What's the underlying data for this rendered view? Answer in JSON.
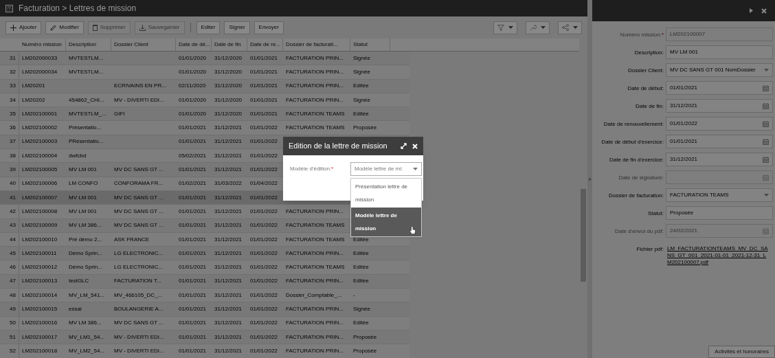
{
  "window": {
    "title": "Facturation > Lettres de mission"
  },
  "toolbar": {
    "buttons": [
      {
        "kind": "icon",
        "label": "Ajouter",
        "disabled": false
      },
      {
        "kind": "icon",
        "label": "Modifier",
        "disabled": false
      },
      {
        "kind": "icon",
        "label": "Supprimer",
        "disabled": true
      },
      {
        "kind": "icon",
        "label": "Sauvegarder",
        "disabled": true
      },
      {
        "kind": "text",
        "label": "Editer",
        "disabled": false
      },
      {
        "kind": "text",
        "label": "Signer",
        "disabled": false
      },
      {
        "kind": "text",
        "label": "Envoyer",
        "disabled": false
      }
    ]
  },
  "table": {
    "columns": [
      "Numéro mission",
      "Description",
      "Dossier Client",
      "Date de dé...",
      "Date de fin",
      "Date de re...",
      "Dossier de facturati...",
      "Statut"
    ],
    "rows": [
      {
        "number": "31",
        "selected": false,
        "cells": [
          "LM202000033",
          "MVTESTLM...",
          null,
          "01/01/2020",
          "31/12/2020",
          "01/01/2021",
          "FACTURATION PRIN...",
          "Signée"
        ]
      },
      {
        "number": "32",
        "selected": false,
        "cells": [
          "LM202000034",
          "MVTESTLM...",
          null,
          "01/01/2020",
          "31/12/2020",
          "01/01/2021",
          "FACTURATION PRIN...",
          "Signée"
        ]
      },
      {
        "number": "33",
        "selected": false,
        "cells": [
          "LM20201",
          null,
          "ECRIVAINS EN PR...",
          "02/11/2020",
          "31/12/2020",
          "01/01/2021",
          "FACTURATION PRIN...",
          "Editée"
        ]
      },
      {
        "number": "34",
        "selected": false,
        "cells": [
          "LM20202",
          "454862_CHI...",
          "MV - DIVERTI EDI...",
          "01/01/2020",
          "31/12/2020",
          "01/01/2021",
          "FACTURATION PRIN...",
          "Signée"
        ]
      },
      {
        "number": "35",
        "selected": false,
        "cells": [
          "LM202100001",
          "MVTESTLM_...",
          "GIFI",
          "01/01/2020",
          "31/12/2020",
          "01/01/2021",
          "FACTURATION TEAMS",
          "Editée"
        ]
      },
      {
        "number": "36",
        "selected": false,
        "cells": [
          "LM202100002",
          "Présentatio...",
          null,
          "01/01/2021",
          "31/12/2021",
          "01/01/2022",
          "FACTURATION TEAMS",
          "Proposée"
        ]
      },
      {
        "number": "37",
        "selected": false,
        "cells": [
          "LM202100003",
          "PRésentatio...",
          null,
          "01/01/2021",
          "31/12/2021",
          "01/01/2022",
          null,
          null
        ]
      },
      {
        "number": "38",
        "selected": false,
        "cells": [
          "LM202100004",
          "dwfcbd",
          null,
          "05/02/2021",
          "31/12/2021",
          "01/01/2022",
          null,
          null
        ]
      },
      {
        "number": "39",
        "selected": false,
        "cells": [
          "LM202100005",
          "MV LM 001",
          "MV DC SANS GT ...",
          "01/01/2021",
          "31/12/2021",
          "01/01/2022",
          null,
          null
        ]
      },
      {
        "number": "40",
        "selected": false,
        "cells": [
          "LM202100006",
          "LM CONFO",
          "CONFORAMA FR...",
          "01/02/2021",
          "31/03/2022",
          "01/04/2022",
          null,
          null
        ]
      },
      {
        "number": "41",
        "selected": true,
        "cells": [
          "LM202100007",
          "MV LM 001",
          "MV DC SANS GT ...",
          "01/01/2021",
          "31/12/2021",
          "01/01/2022",
          null,
          null
        ]
      },
      {
        "number": "42",
        "selected": false,
        "cells": [
          "LM202100008",
          "MV LM 001",
          "MV DC SANS GT ...",
          "01/01/2021",
          "31/12/2021",
          "01/01/2022",
          "FACTURATION PRIN...",
          null
        ]
      },
      {
        "number": "43",
        "selected": false,
        "cells": [
          "LM202100009",
          "MV LM 386...",
          "MV DC SANS GT ...",
          "01/01/2021",
          "31/12/2021",
          "01/01/2022",
          "FACTURATION TEAMS",
          null
        ]
      },
      {
        "number": "44",
        "selected": false,
        "cells": [
          "LM202100010",
          "Pré démo 2...",
          "ASK FRANCE",
          "01/01/2021",
          "31/12/2021",
          "01/01/2022",
          "FACTURATION TEAMS",
          "Editée"
        ]
      },
      {
        "number": "45",
        "selected": false,
        "cells": [
          "LM202100011",
          "Démo Sprin...",
          "LG ELECTRONIC...",
          "01/01/2021",
          "31/12/2021",
          "01/01/2022",
          "FACTURATION PRIN...",
          "Editée"
        ]
      },
      {
        "number": "46",
        "selected": false,
        "cells": [
          "LM202100012",
          "Démo Sprin...",
          "LG ELECTRONIC...",
          "01/01/2021",
          "31/12/2021",
          "01/01/2022",
          "FACTURATION TEAMS",
          "Editée"
        ]
      },
      {
        "number": "47",
        "selected": false,
        "cells": [
          "LM202100013",
          "testGLC",
          "FACTURATION T...",
          "01/01/2021",
          "31/12/2021",
          "01/01/2022",
          "FACTURATION PRIN...",
          "Editée"
        ]
      },
      {
        "number": "48",
        "selected": false,
        "cells": [
          "LM202100014",
          "MV_LM_541...",
          "MV_466105_DC_...",
          "01/01/2021",
          "31/12/2021",
          "01/01/2022",
          "Dossier_Comptable_...",
          "-"
        ]
      },
      {
        "number": "49",
        "selected": false,
        "cells": [
          "LM202100015",
          "essai",
          "BOULANGERIE A...",
          "01/01/2021",
          "31/12/2021",
          "01/01/2022",
          "FACTURATION PRIN...",
          "Signée"
        ]
      },
      {
        "number": "50",
        "selected": false,
        "cells": [
          "LM202100016",
          "MV LM 386...",
          "MV DC SANS GT ...",
          "01/01/2021",
          "31/12/2021",
          "01/01/2022",
          "FACTURATION PRIN...",
          "Editée"
        ]
      },
      {
        "number": "51",
        "selected": false,
        "cells": [
          "LM202100017",
          "MV_LM1_54...",
          "MV - DIVERTI EDI...",
          "01/01/2021",
          "31/12/2021",
          "01/01/2022",
          "FACTURATION PRIN...",
          "Proposée"
        ]
      },
      {
        "number": "52",
        "selected": false,
        "cells": [
          "LM202100018",
          "MV_LM2_54...",
          "MV - DIVERTI EDI...",
          "01/01/2021",
          "31/12/2021",
          "01/01/2022",
          "FACTURATION PRIN...",
          "Proposée"
        ]
      }
    ]
  },
  "dialog": {
    "title": "Edition de la lettre de mission",
    "field": {
      "label": "Modèle d'édition:",
      "required_mark": "*",
      "value": "Modèle lettre de mi:"
    },
    "options": [
      {
        "label": "Présentation lettre de mission",
        "selected": false
      },
      {
        "label": "Modèle lettre de mission",
        "selected": true
      }
    ]
  },
  "detail": {
    "fields": [
      {
        "kind": "text",
        "label": "Numéro mission:",
        "required_mark": "*",
        "disabled": true,
        "value": "LM202100007"
      },
      {
        "kind": "text",
        "label": "Description:",
        "disabled": false,
        "value": "MV LM 001"
      },
      {
        "kind": "select",
        "label": "Dossier Client:",
        "disabled": false,
        "value": "MV DC SANS GT 001 NomDossier"
      },
      {
        "kind": "date",
        "label": "Date de début:",
        "disabled": false,
        "value": "01/01/2021"
      },
      {
        "kind": "date",
        "label": "Date de fin:",
        "disabled": false,
        "value": "31/12/2021"
      },
      {
        "kind": "date",
        "label": "Date de renouvellement:",
        "disabled": false,
        "value": "01/01/2022"
      },
      {
        "kind": "date",
        "label": "Date de début d'exercice:",
        "disabled": false,
        "value": "01/01/2021"
      },
      {
        "kind": "date",
        "label": "Date de fin d'exercice:",
        "disabled": false,
        "value": "31/12/2021"
      },
      {
        "kind": "date",
        "label": "Date de signature:",
        "disabled": true
      },
      {
        "kind": "select",
        "label": "Dossier de facturation:",
        "disabled": false,
        "value": "FACTURATION TEAMS"
      },
      {
        "kind": "text",
        "label": "Statut:",
        "disabled": false,
        "value": "Proposée"
      },
      {
        "kind": "date",
        "label": "Date d'envoi du pdf:",
        "disabled": true,
        "value": "24/02/2021"
      },
      {
        "kind": "link",
        "label": "Fichier pdf:",
        "disabled": false,
        "value": "LM_FACTURATIONTEAMS_MV_DC_SANS_GT_001_2021-01-01_2021-12-31_LM202100007.pdf"
      }
    ],
    "button": "Activités et honoraires"
  }
}
